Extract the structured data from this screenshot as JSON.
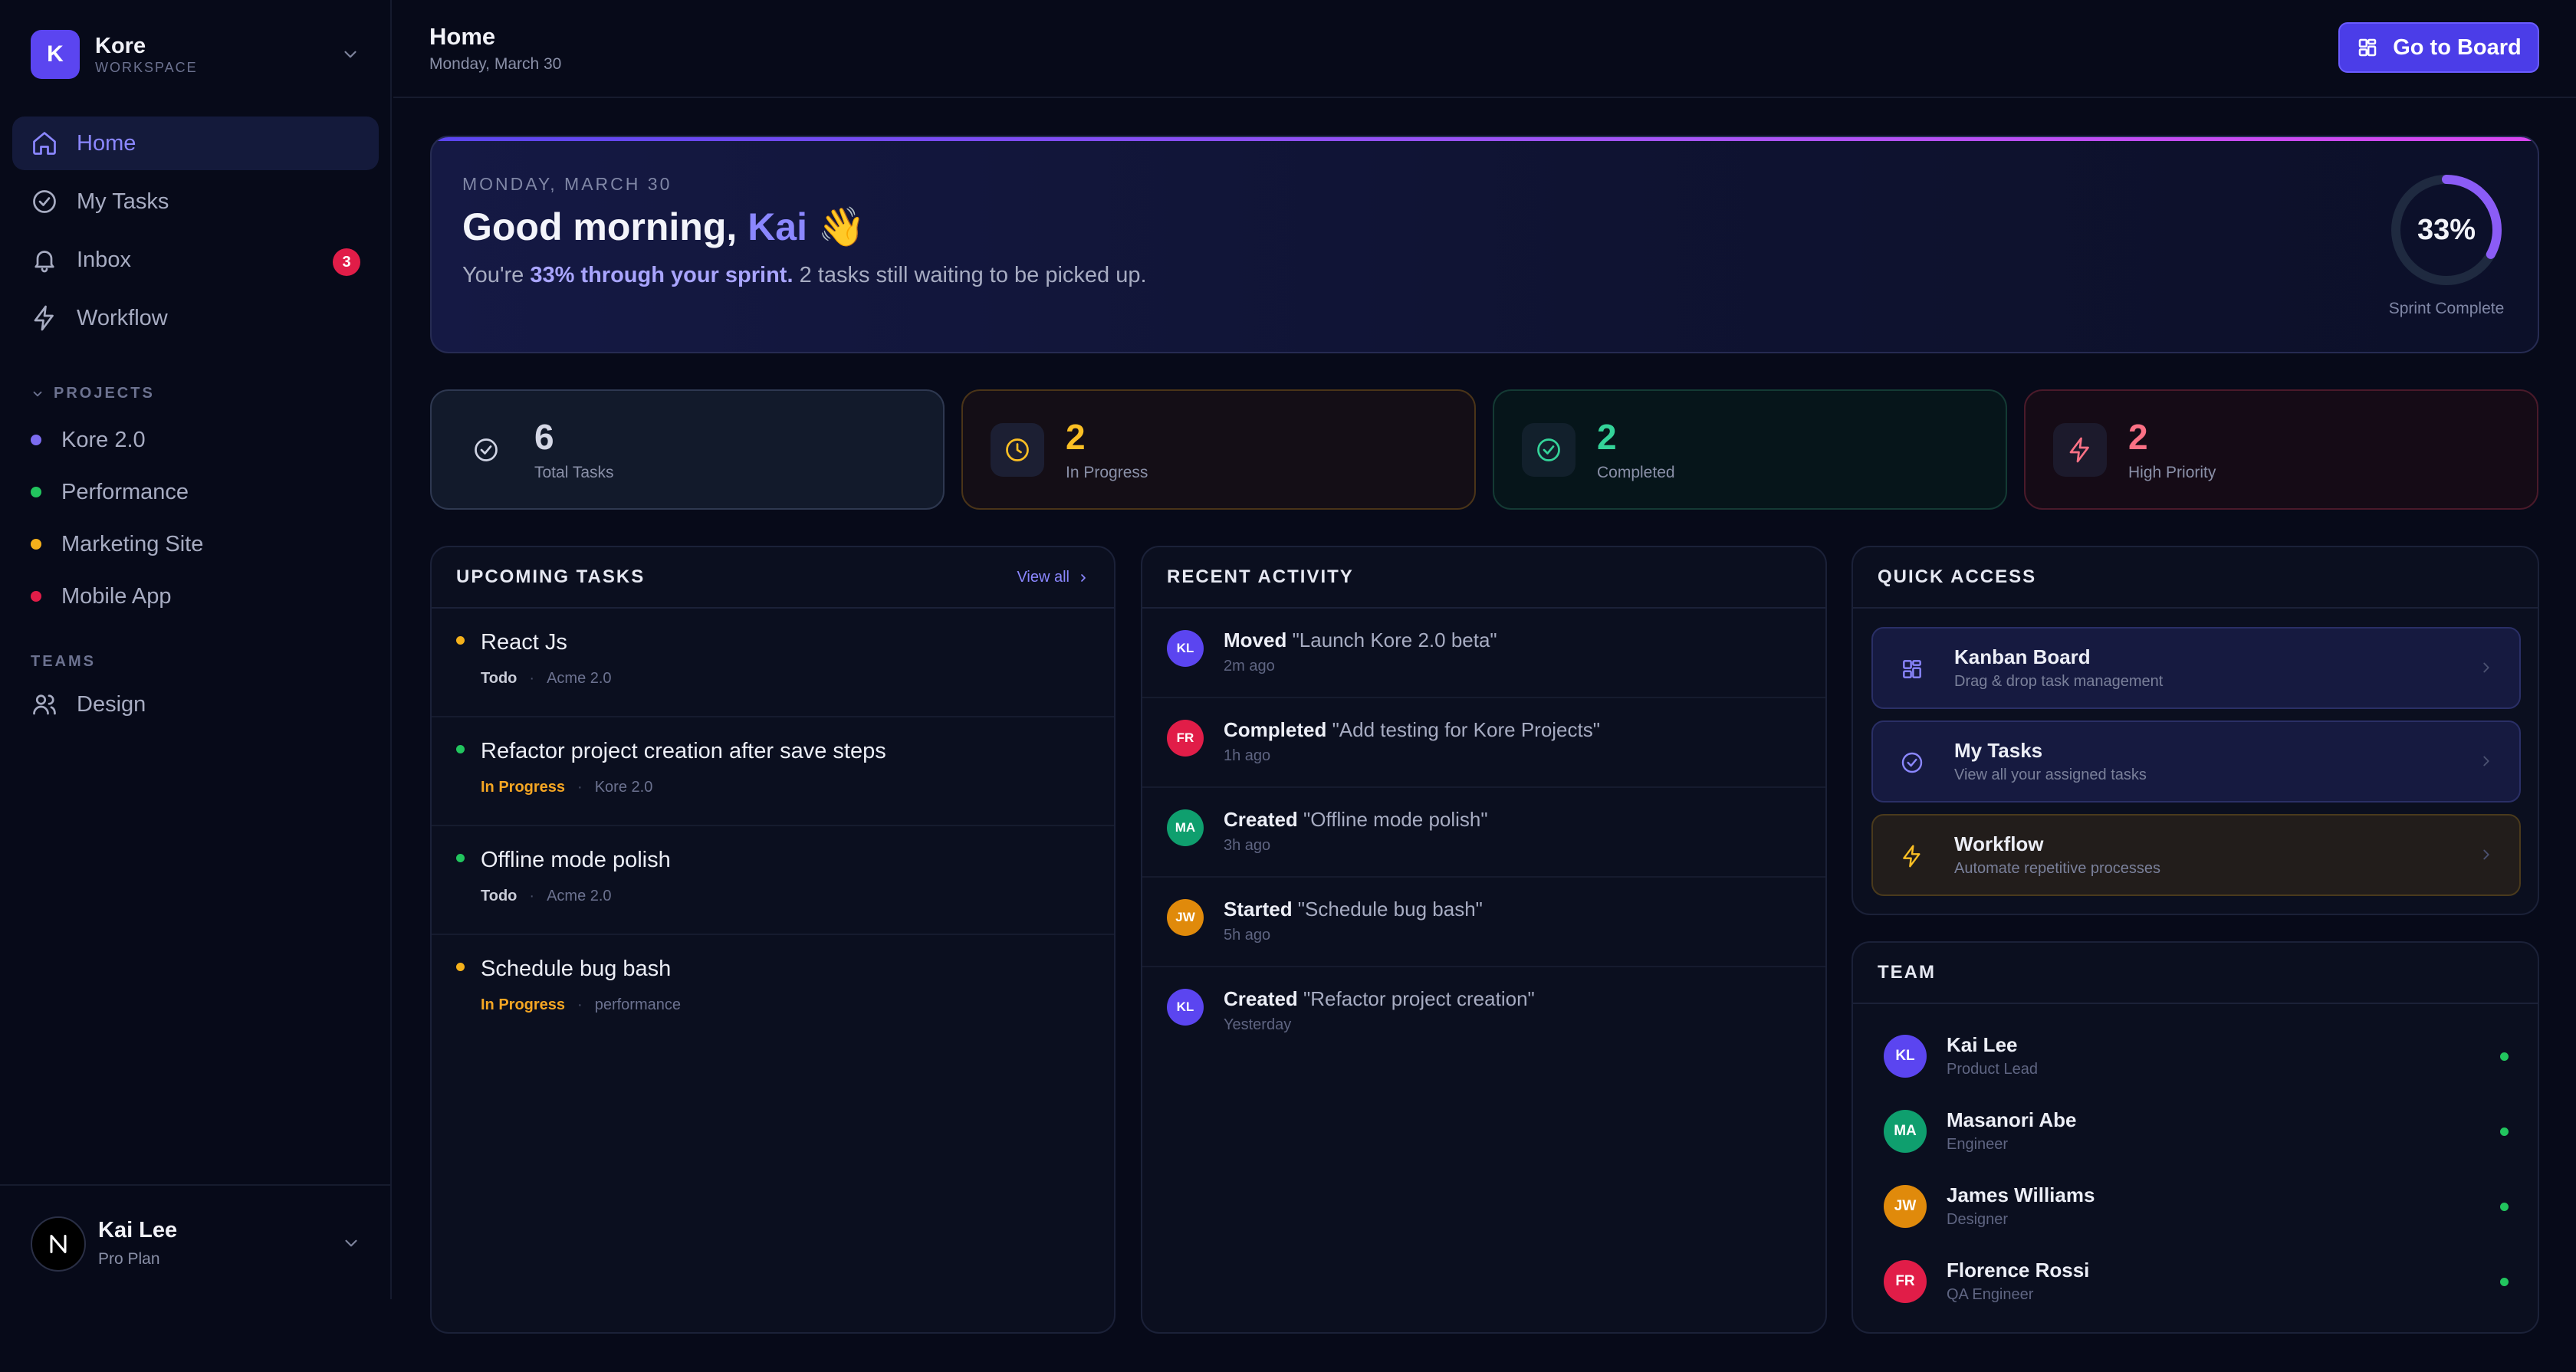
{
  "workspace": {
    "initial": "K",
    "name": "Kore",
    "label": "WORKSPACE"
  },
  "nav": [
    {
      "label": "Home",
      "icon": "home-icon",
      "active": true
    },
    {
      "label": "My Tasks",
      "icon": "check-circle-icon"
    },
    {
      "label": "Inbox",
      "icon": "bell-icon",
      "badge": "3"
    },
    {
      "label": "Workflow",
      "icon": "lightning-icon"
    }
  ],
  "projects": {
    "heading": "PROJECTS",
    "items": [
      {
        "label": "Kore 2.0",
        "color": "#7c6cf0"
      },
      {
        "label": "Performance",
        "color": "#22c55e"
      },
      {
        "label": "Marketing Site",
        "color": "#f5b11b"
      },
      {
        "label": "Mobile App",
        "color": "#e11d48"
      }
    ]
  },
  "teams": {
    "heading": "TEAMS",
    "items": [
      {
        "label": "Design",
        "icon": "users-icon"
      }
    ]
  },
  "user": {
    "name": "Kai Lee",
    "plan": "Pro Plan"
  },
  "header": {
    "title": "Home",
    "date": "Monday, March 30",
    "button": "Go to Board"
  },
  "hero": {
    "kicker": "MONDAY, MARCH 30",
    "greeting": "Good morning,",
    "name": "Kai",
    "emoji": "👋",
    "desc_pre": "You're ",
    "desc_highlight": "33% through your sprint.",
    "desc_post": " 2 tasks still waiting to be picked up.",
    "progress_label": "33%",
    "progress_value": 0.33,
    "progress_caption": "Sprint Complete"
  },
  "stats": [
    {
      "value": "6",
      "label": "Total Tasks",
      "icon": "check-circle-icon",
      "color": "#cfd3e3"
    },
    {
      "value": "2",
      "label": "In Progress",
      "icon": "clock-icon",
      "color": "#fbbf24"
    },
    {
      "value": "2",
      "label": "Completed",
      "icon": "check-circle-icon",
      "color": "#34d399"
    },
    {
      "value": "2",
      "label": "High Priority",
      "icon": "lightning-icon",
      "color": "#fb7185"
    }
  ],
  "upcoming": {
    "title": "UPCOMING TASKS",
    "view_all": "View all",
    "tasks": [
      {
        "title": "React Js",
        "status": "Todo",
        "status_color": "#c9ccd8",
        "project": "Acme 2.0",
        "dot": "#f5b11b"
      },
      {
        "title": "Refactor project creation after save steps",
        "status": "In Progress",
        "status_color": "#f5a623",
        "project": "Kore 2.0",
        "dot": "#22c55e"
      },
      {
        "title": "Offline mode polish",
        "status": "Todo",
        "status_color": "#c9ccd8",
        "project": "Acme 2.0",
        "dot": "#22c55e"
      },
      {
        "title": "Schedule bug bash",
        "status": "In Progress",
        "status_color": "#f5a623",
        "project": "performance",
        "dot": "#f5b11b"
      }
    ]
  },
  "activity": {
    "title": "RECENT ACTIVITY",
    "items": [
      {
        "initials": "KL",
        "color": "#5b45f0",
        "action": "Moved",
        "target": " \"Launch Kore 2.0 beta\"",
        "time": "2m ago"
      },
      {
        "initials": "FR",
        "color": "#e11d48",
        "action": "Completed",
        "target": " \"Add testing for Kore Projects\"",
        "time": "1h ago"
      },
      {
        "initials": "MA",
        "color": "#0f9f6e",
        "action": "Created",
        "target": " \"Offline mode polish\"",
        "time": "3h ago"
      },
      {
        "initials": "JW",
        "color": "#e08a0b",
        "action": "Started",
        "target": " \"Schedule bug bash\"",
        "time": "5h ago"
      },
      {
        "initials": "KL",
        "color": "#5b45f0",
        "action": "Created",
        "target": " \"Refactor project creation\"",
        "time": "Yesterday"
      }
    ]
  },
  "quick_access": {
    "title": "QUICK ACCESS",
    "items": [
      {
        "title": "Kanban Board",
        "desc": "Drag & drop task management",
        "icon": "board-icon"
      },
      {
        "title": "My Tasks",
        "desc": "View all your assigned tasks",
        "icon": "check-circle-icon"
      },
      {
        "title": "Workflow",
        "desc": "Automate repetitive processes",
        "icon": "lightning-icon"
      }
    ]
  },
  "team": {
    "title": "TEAM",
    "members": [
      {
        "initials": "KL",
        "color": "#5b45f0",
        "name": "Kai Lee",
        "role": "Product Lead"
      },
      {
        "initials": "MA",
        "color": "#0f9f6e",
        "name": "Masanori Abe",
        "role": "Engineer"
      },
      {
        "initials": "JW",
        "color": "#e08a0b",
        "name": "James Williams",
        "role": "Designer"
      },
      {
        "initials": "FR",
        "color": "#e11d48",
        "name": "Florence Rossi",
        "role": "QA Engineer"
      }
    ]
  }
}
